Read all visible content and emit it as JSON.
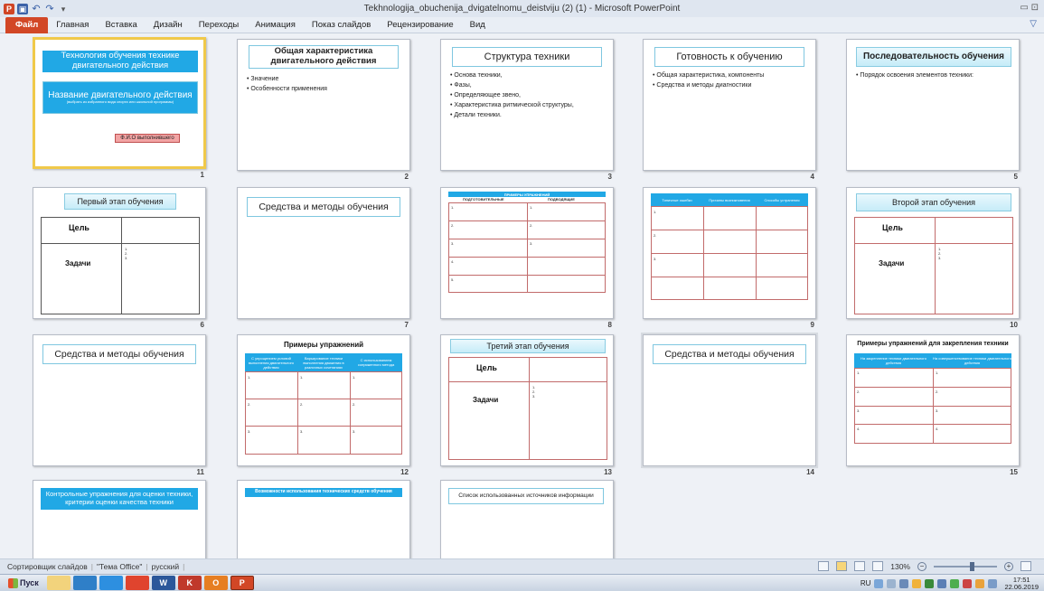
{
  "window": {
    "title": "Tekhnologija_obuchenija_dvigatelnomu_deistviju (2) (1) - Microsoft PowerPoint",
    "controls": "▭ ⊡",
    "help_icon": "help-icon",
    "app_glyph": "P",
    "undo_glyph": "↶",
    "redo_glyph": "↷",
    "more_glyph": "▾"
  },
  "ribbon": {
    "tabs": [
      "Файл",
      "Главная",
      "Вставка",
      "Дизайн",
      "Переходы",
      "Анимация",
      "Показ слайдов",
      "Рецензирование",
      "Вид"
    ],
    "help_glyph": "▽"
  },
  "slides": {
    "s1": {
      "title": "Технология обучения технике двигательного действия",
      "name_title": "Название двигательного действия",
      "name_hint": "(выбрать из избранного вида спорта или школьной программы)",
      "author": "Ф.И.О выполнившего",
      "num": "1"
    },
    "s2": {
      "title": "Общая характеристика двигательного действия",
      "bullets": [
        "Значение",
        "Особенности применения"
      ],
      "num": "2"
    },
    "s3": {
      "title": "Структура техники",
      "bullets": [
        "Основа техники,",
        "Фазы,",
        "Определяющее звено,",
        "Характеристика ритмической структуры,",
        "Детали техники."
      ],
      "num": "3"
    },
    "s4": {
      "title": "Готовность к обучению",
      "bullets": [
        "Общая характеристика, компоненты",
        "Средства и методы диагностики"
      ],
      "num": "4"
    },
    "s5": {
      "title": "Последовательность обучения",
      "bullets": [
        "Порядок освоения элементов техники:"
      ],
      "num": "5"
    },
    "s6": {
      "title": "Первый этап обучения",
      "goal": "Цель",
      "tasks": "Задачи",
      "list": "1.\n2.\n3.",
      "num": "6"
    },
    "s7": {
      "title": "Средства и методы обучения",
      "num": "7"
    },
    "s8": {
      "header": "ПРИМЕРЫ УПРАЖНЕНИЙ",
      "col1": "ПОДГОТОВИТЕЛЬНЫЕ",
      "col2": "ПОДВОДЯЩИЕ",
      "rows_left": [
        "1.",
        "2.",
        "3.",
        "4.",
        "5."
      ],
      "rows_right": [
        "1.",
        "2.",
        "3."
      ],
      "num": "8"
    },
    "s9": {
      "cols": [
        "Типичные ошибки",
        "Причины возникновения",
        "Способы устранения"
      ],
      "rows": [
        "1.",
        "2.",
        "3."
      ],
      "num": "9"
    },
    "s10": {
      "title": "Второй этап обучения",
      "goal": "Цель",
      "tasks": "Задачи",
      "list": "1.\n2.\n3.",
      "num": "10"
    },
    "s11": {
      "title": "Средства и методы обучения",
      "num": "11"
    },
    "s12": {
      "title": "Примеры упражнений",
      "cols": [
        "С упрощением условий выполнения двигательного действия",
        "Варьирование техники выполнения движения в различных сочетаниях",
        "С использованием сопряженного метода"
      ],
      "rows": [
        "1.",
        "2.",
        "3."
      ],
      "num": "12"
    },
    "s13": {
      "title": "Третий этап обучения",
      "goal": "Цель",
      "tasks": "Задачи",
      "list": "1.\n2.\n3.",
      "num": "13"
    },
    "s14": {
      "title": "Средства и методы обучения",
      "num": "14"
    },
    "s15": {
      "title": "Примеры упражнений для закрепления техники",
      "cols": [
        "На закрепление техники двигательного действия",
        "На совершенствование техники двигательного действия"
      ],
      "rows": [
        "1.",
        "2.",
        "3.",
        "4."
      ],
      "num": "15"
    },
    "s16": {
      "title": "Контрольные упражнения для оценки техники, критерии оценки качества техники"
    },
    "s17": {
      "title": "Возможности использования технических средств обучения"
    },
    "s18": {
      "title": "Список использованных источников информации"
    }
  },
  "status": {
    "view": "Сортировщик слайдов",
    "theme": "\"Тема Office\"",
    "lang": "русский",
    "zoom": "130%"
  },
  "taskbar": {
    "start": "Пуск",
    "tray_lang": "RU",
    "time": "17:51",
    "date": "22.06.2019",
    "app_glyphs": [
      "",
      "",
      "",
      "",
      "W",
      "K",
      "O",
      "P"
    ]
  },
  "colors": {
    "accent": "#21a8e5",
    "file_tab": "#d24726",
    "selection": "#f0c94a"
  }
}
